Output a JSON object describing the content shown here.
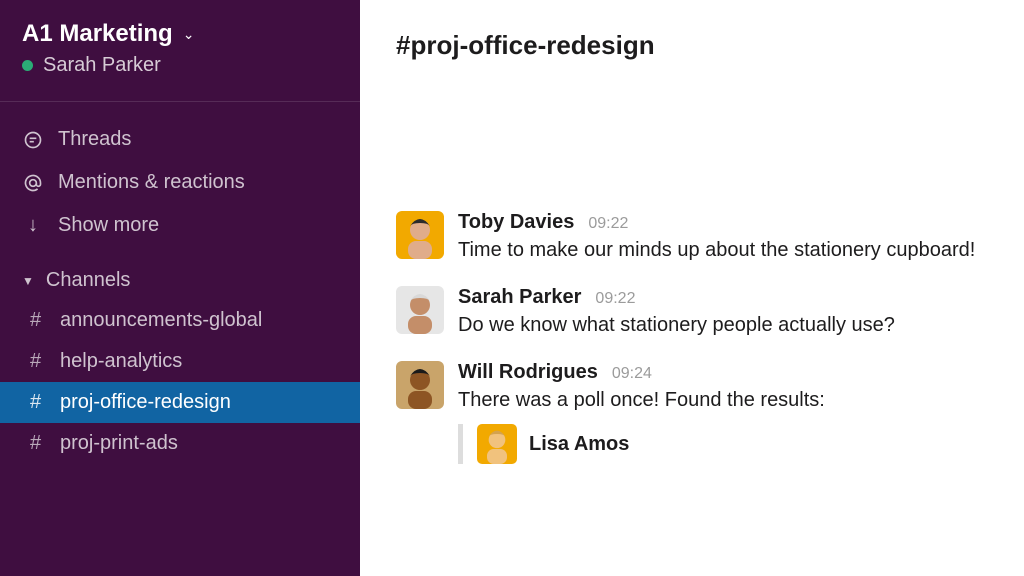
{
  "workspace": {
    "name": "A1 Marketing",
    "user": "Sarah Parker"
  },
  "nav": {
    "threads": "Threads",
    "mentions": "Mentions & reactions",
    "showMore": "Show more"
  },
  "channels": {
    "header": "Channels",
    "items": [
      {
        "name": "announcements-global",
        "active": false
      },
      {
        "name": "help-analytics",
        "active": false
      },
      {
        "name": "proj-office-redesign",
        "active": true
      },
      {
        "name": "proj-print-ads",
        "active": false
      }
    ]
  },
  "channel": {
    "title": "#proj-office-redesign"
  },
  "messages": [
    {
      "author": "Toby Davies",
      "time": "09:22",
      "text": "Time to make our minds up about the stationery cupboard!",
      "avatarBg": "#F2A900"
    },
    {
      "author": "Sarah Parker",
      "time": "09:22",
      "text": "Do we know what stationery people actually use?",
      "avatarBg": "#E6E6E6"
    },
    {
      "author": "Will Rodrigues",
      "time": "09:24",
      "text": "There was a poll once! Found the results:",
      "avatarBg": "#C9A46A",
      "nested": {
        "author": "Lisa Amos",
        "avatarBg": "#F2A900"
      }
    }
  ]
}
